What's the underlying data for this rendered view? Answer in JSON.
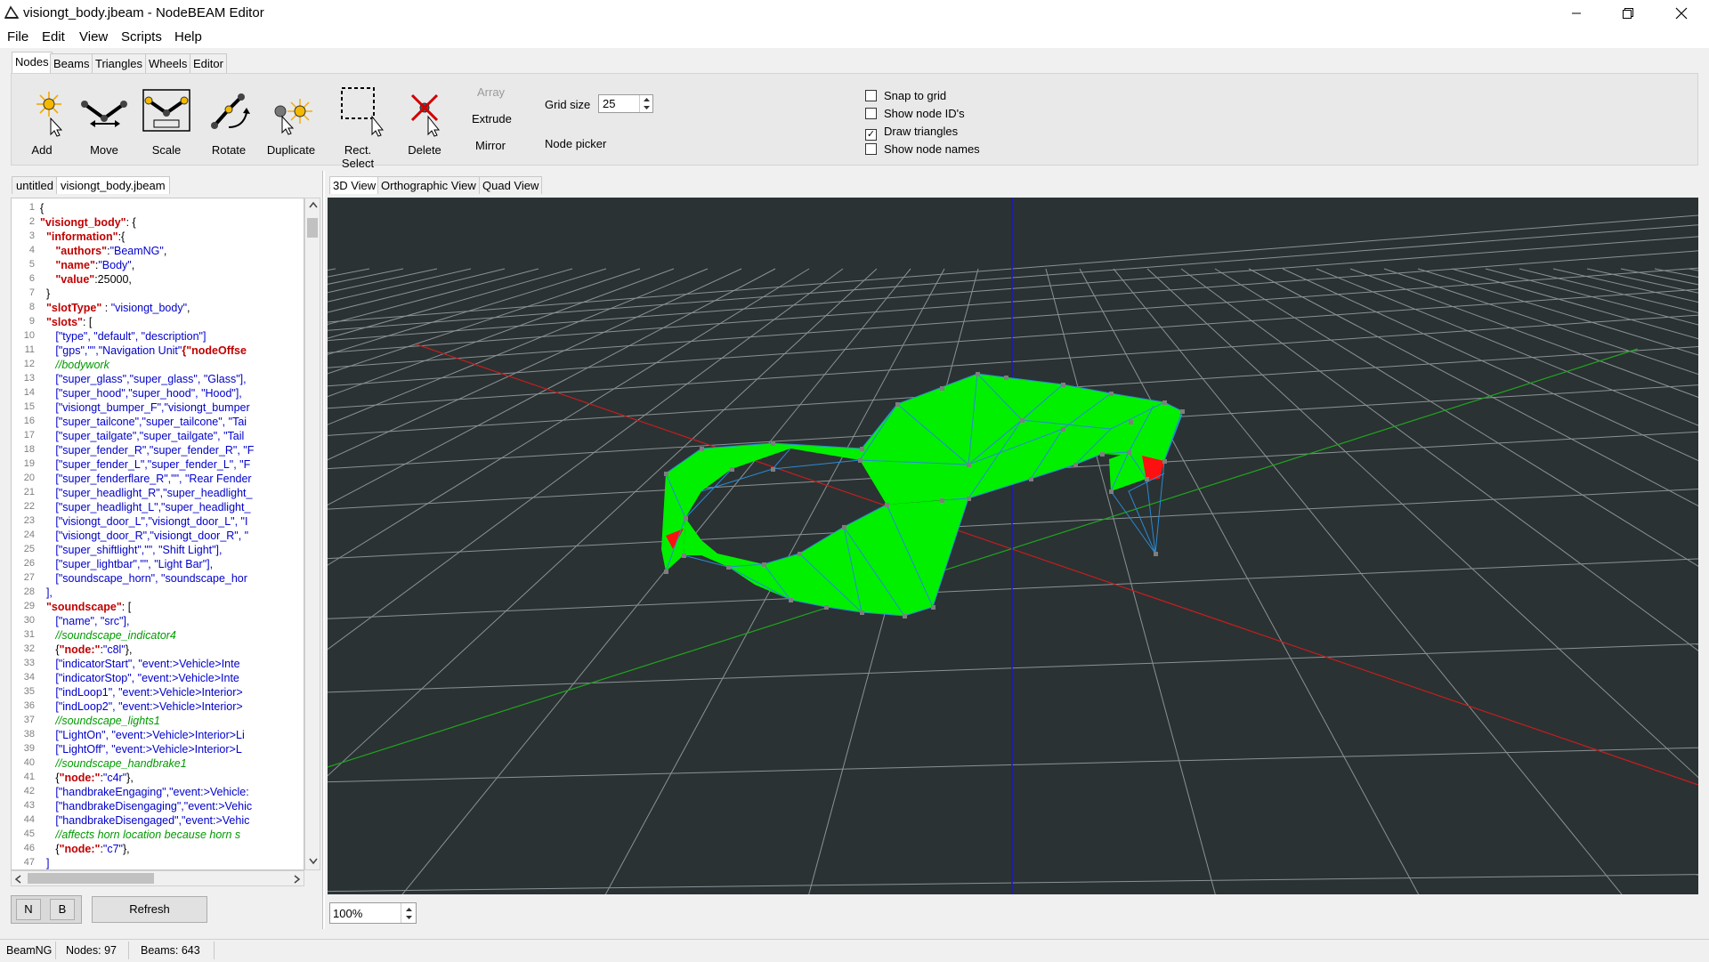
{
  "window": {
    "title": "visiongt_body.jbeam - NodeBEAM Editor"
  },
  "menu": [
    "File",
    "Edit",
    "View",
    "Scripts",
    "Help"
  ],
  "tool_tabs": [
    "Nodes",
    "Beams",
    "Triangles",
    "Wheels",
    "Editor"
  ],
  "tools": {
    "add": "Add",
    "move": "Move",
    "scale": "Scale",
    "rotate": "Rotate",
    "duplicate": "Duplicate",
    "rect_select": "Rect. Select",
    "delete": "Delete",
    "array": "Array",
    "extrude": "Extrude",
    "mirror": "Mirror",
    "grid_size_label": "Grid size",
    "grid_size_value": "25",
    "node_picker": "Node picker"
  },
  "options": {
    "snap_to_grid": "Snap to grid",
    "show_node_ids": "Show node ID's",
    "draw_triangles": "Draw triangles",
    "show_node_names": "Show node names",
    "draw_triangles_checked": true
  },
  "file_tabs": [
    "untitled",
    "visiongt_body.jbeam"
  ],
  "view_tabs": [
    "3D View",
    "Orthographic View",
    "Quad View"
  ],
  "code_lines": [
    [
      [
        "p",
        "{"
      ]
    ],
    [
      [
        "k",
        "\"visiongt_body\""
      ],
      [
        "p",
        ": {"
      ]
    ],
    [
      [
        "i",
        "  "
      ],
      [
        "k",
        "\"information\""
      ],
      [
        "p",
        ":{"
      ]
    ],
    [
      [
        "i",
        "     "
      ],
      [
        "k",
        "\"authors\""
      ],
      [
        "p",
        ":"
      ],
      [
        "s",
        "\"BeamNG\""
      ],
      [
        "p",
        ","
      ]
    ],
    [
      [
        "i",
        "     "
      ],
      [
        "k",
        "\"name\""
      ],
      [
        "p",
        ":"
      ],
      [
        "s",
        "\"Body\""
      ],
      [
        "p",
        ","
      ]
    ],
    [
      [
        "i",
        "     "
      ],
      [
        "k",
        "\"value\""
      ],
      [
        "p",
        ":25000,"
      ]
    ],
    [
      [
        "i",
        "  "
      ],
      [
        "p",
        "}"
      ]
    ],
    [
      [
        "i",
        "  "
      ],
      [
        "k",
        "\"slotType\""
      ],
      [
        "p",
        " : "
      ],
      [
        "s",
        "\"visiongt_body\""
      ],
      [
        "p",
        ","
      ]
    ],
    [
      [
        "i",
        "  "
      ],
      [
        "k",
        "\"slots\""
      ],
      [
        "p",
        ": ["
      ]
    ],
    [
      [
        "i",
        "     "
      ],
      [
        "s",
        "[\"type\", \"default\", \"description\"]"
      ]
    ],
    [
      [
        "i",
        "     "
      ],
      [
        "s",
        "[\"gps\",\"\",\"Navigation Unit\""
      ],
      [
        "k",
        "{\"nodeOffse"
      ]
    ],
    [
      [
        "i",
        "     "
      ],
      [
        "c",
        "//bodywork"
      ]
    ],
    [
      [
        "i",
        "     "
      ],
      [
        "s",
        "[\"super_glass\",\"super_glass\", \"Glass\"],"
      ]
    ],
    [
      [
        "i",
        "     "
      ],
      [
        "s",
        "[\"super_hood\",\"super_hood\", \"Hood\"],"
      ]
    ],
    [
      [
        "i",
        "     "
      ],
      [
        "s",
        "[\"visiongt_bumper_F\",\"visiongt_bumper"
      ]
    ],
    [
      [
        "i",
        "     "
      ],
      [
        "s",
        "[\"super_tailcone\",\"super_tailcone\", \"Tai"
      ]
    ],
    [
      [
        "i",
        "     "
      ],
      [
        "s",
        "[\"super_tailgate\",\"super_tailgate\", \"Tail"
      ]
    ],
    [
      [
        "i",
        "     "
      ],
      [
        "s",
        "[\"super_fender_R\",\"super_fender_R\", \"F"
      ]
    ],
    [
      [
        "i",
        "     "
      ],
      [
        "s",
        "[\"super_fender_L\",\"super_fender_L\", \"F"
      ]
    ],
    [
      [
        "i",
        "     "
      ],
      [
        "s",
        "[\"super_fenderflare_R\",\"\", \"Rear Fender"
      ]
    ],
    [
      [
        "i",
        "     "
      ],
      [
        "s",
        "[\"super_headlight_R\",\"super_headlight_"
      ]
    ],
    [
      [
        "i",
        "     "
      ],
      [
        "s",
        "[\"super_headlight_L\",\"super_headlight_"
      ]
    ],
    [
      [
        "i",
        "     "
      ],
      [
        "s",
        "[\"visiongt_door_L\",\"visiongt_door_L\", \"I"
      ]
    ],
    [
      [
        "i",
        "     "
      ],
      [
        "s",
        "[\"visiongt_door_R\",\"visiongt_door_R\", \""
      ]
    ],
    [
      [
        "i",
        "     "
      ],
      [
        "s",
        "[\"super_shiftlight\",\"\", \"Shift Light\"],"
      ]
    ],
    [
      [
        "i",
        "     "
      ],
      [
        "s",
        "[\"super_lightbar\",\"\", \"Light Bar\"],"
      ]
    ],
    [
      [
        "i",
        "     "
      ],
      [
        "s",
        "[\"soundscape_horn\", \"soundscape_hor"
      ]
    ],
    [
      [
        "i",
        "  "
      ],
      [
        "s",
        "],"
      ]
    ],
    [
      [
        "i",
        "  "
      ],
      [
        "k",
        "\"soundscape\""
      ],
      [
        "p",
        ": ["
      ]
    ],
    [
      [
        "i",
        "     "
      ],
      [
        "s",
        "[\"name\", \"src\"],"
      ]
    ],
    [
      [
        "i",
        "     "
      ],
      [
        "c",
        "//soundscape_indicator4"
      ]
    ],
    [
      [
        "i",
        "     "
      ],
      [
        "p",
        "{"
      ],
      [
        "k",
        "\"node:\""
      ],
      [
        "p",
        ":"
      ],
      [
        "s",
        "\"c8l\""
      ],
      [
        "p",
        "},"
      ]
    ],
    [
      [
        "i",
        "     "
      ],
      [
        "s",
        "[\"indicatorStart\", \"event:>Vehicle>Inte"
      ]
    ],
    [
      [
        "i",
        "     "
      ],
      [
        "s",
        "[\"indicatorStop\", \"event:>Vehicle>Inte"
      ]
    ],
    [
      [
        "i",
        "     "
      ],
      [
        "s",
        "[\"indLoop1\", \"event:>Vehicle>Interior>"
      ]
    ],
    [
      [
        "i",
        "     "
      ],
      [
        "s",
        "[\"indLoop2\", \"event:>Vehicle>Interior>"
      ]
    ],
    [
      [
        "i",
        "     "
      ],
      [
        "c",
        "//soundscape_lights1"
      ]
    ],
    [
      [
        "i",
        "     "
      ],
      [
        "s",
        "[\"LightOn\", \"event:>Vehicle>Interior>Li"
      ]
    ],
    [
      [
        "i",
        "     "
      ],
      [
        "s",
        "[\"LightOff\", \"event:>Vehicle>Interior>L"
      ]
    ],
    [
      [
        "i",
        "     "
      ],
      [
        "c",
        "//soundscape_handbrake1"
      ]
    ],
    [
      [
        "i",
        "     "
      ],
      [
        "p",
        "{"
      ],
      [
        "k",
        "\"node:\""
      ],
      [
        "p",
        ":"
      ],
      [
        "s",
        "\"c4r\""
      ],
      [
        "p",
        "},"
      ]
    ],
    [
      [
        "i",
        "     "
      ],
      [
        "s",
        "[\"handbrakeEngaging\",\"event:>Vehicle:"
      ]
    ],
    [
      [
        "i",
        "     "
      ],
      [
        "s",
        "[\"handbrakeDisengaging\",\"event:>Vehic"
      ]
    ],
    [
      [
        "i",
        "     "
      ],
      [
        "s",
        "[\"handbrakeDisengaged\",\"event:>Vehic"
      ]
    ],
    [
      [
        "i",
        "     "
      ],
      [
        "c",
        "//affects horn location because horn s"
      ]
    ],
    [
      [
        "i",
        "     "
      ],
      [
        "p",
        "{"
      ],
      [
        "k",
        "\"node:\""
      ],
      [
        "p",
        ":"
      ],
      [
        "s",
        "\"c7\""
      ],
      [
        "p",
        "},"
      ]
    ],
    [
      [
        "i",
        "  "
      ],
      [
        "s",
        "]"
      ]
    ]
  ],
  "bottom_left": {
    "n_button": "N",
    "b_button": "B",
    "refresh": "Refresh"
  },
  "zoom": "100%",
  "status": {
    "source": "BeamNG",
    "nodes": "Nodes: 97",
    "beams": "Beams: 643"
  }
}
